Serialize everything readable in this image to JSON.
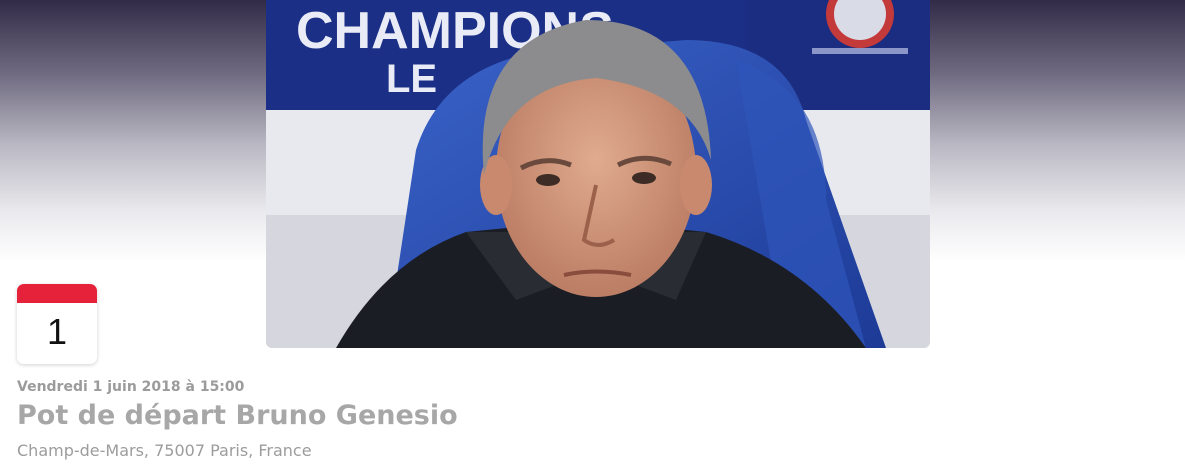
{
  "event": {
    "cover_alt": "Bruno Genesio",
    "cover_banner_text": "CHAMPIONS",
    "cover_banner_text2": "LE",
    "calendar_day": "1",
    "date_time": "Vendredi 1 juin 2018 à 15:00",
    "title": "Pot de départ Bruno Genesio",
    "location": "Champ-de-Mars, 75007 Paris, France"
  },
  "colors": {
    "calendar_accent": "#e5223a",
    "text_muted": "#a7a7a7"
  }
}
